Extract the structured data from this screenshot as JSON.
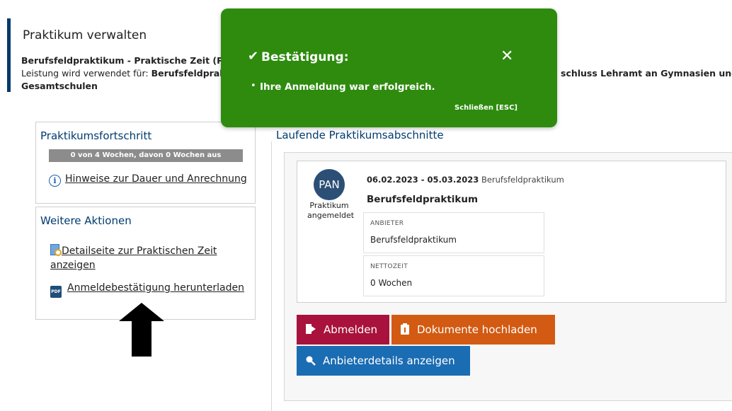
{
  "header": {
    "title": "Praktikum verwalten",
    "subtitle": "Berufsfeldpraktikum - Praktische Zeit (ProBes",
    "usage_prefix": "Leistung wird verwendet für: ",
    "usage_bold": "Berufsfeldpraktik",
    "usage_right": "schluss Lehramt an Gymnasien und",
    "usage_line2": "Gesamtschulen"
  },
  "progress_box": {
    "title": "Praktikumsfortschritt",
    "progress_text": "0 von 4 Wochen, davon 0 Wochen aus",
    "progress_fraction": 0,
    "info_link": "Hinweise zur Dauer und Anrechnung"
  },
  "actions_box": {
    "title": "Weitere Aktionen",
    "details_link": "Detailseite zur Praktischen Zeit anzeigen",
    "pdf_link": "Anmeldebestätigung herunterladen",
    "pdf_icon_text": "PDF"
  },
  "running": {
    "title": "Laufende Praktikumsabschnitte",
    "badge": "PAN",
    "status": "Praktikum angemeldet",
    "date_range": "06.02.2023 - 05.03.2023",
    "type": "Berufsfeldpraktikum",
    "card_title": "Berufsfeldpraktikum",
    "provider_label": "ANBIETER",
    "provider_value": "Berufsfeldpraktikum",
    "net_label": "NETTOZEIT",
    "net_value": "0 Wochen"
  },
  "buttons": {
    "unregister": "Abmelden",
    "upload": "Dokumente hochladen",
    "provider_details": "Anbieterdetails anzeigen"
  },
  "toast": {
    "title": "Bestätigung:",
    "message": "Ihre Anmeldung war erfolgreich.",
    "close_esc": "Schließen [ESC]",
    "close_symbol": "✕",
    "check_symbol": "✔"
  },
  "colors": {
    "brand": "#003b6f",
    "toast_green": "#2e8b0e",
    "btn_red": "#a8123c",
    "btn_orange": "#d25a12",
    "btn_blue": "#1a6cb3"
  }
}
